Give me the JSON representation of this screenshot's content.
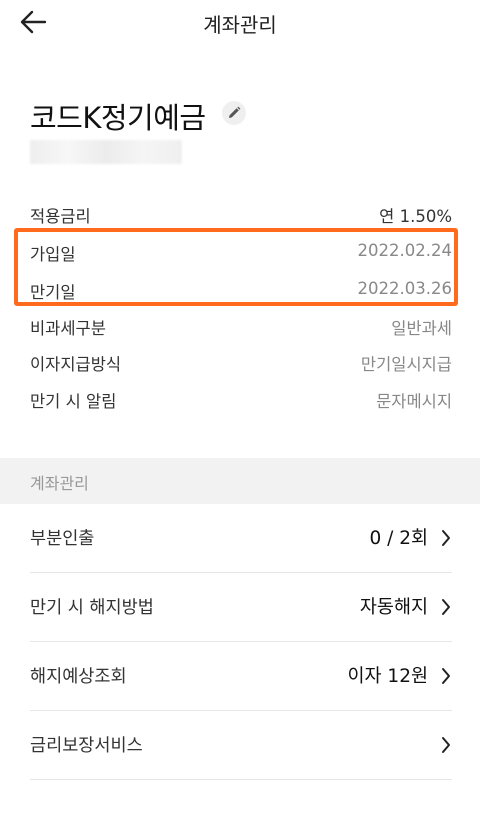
{
  "header": {
    "title": "계좌관리"
  },
  "product": {
    "name": "코드K정기예금"
  },
  "info": {
    "rate": {
      "label": "적용금리",
      "value": "연 1.50%"
    },
    "join_date": {
      "label": "가입일",
      "value": "2022.02.24"
    },
    "maturity_date": {
      "label": "만기일",
      "value": "2022.03.26"
    },
    "tax": {
      "label": "비과세구분",
      "value": "일반과세"
    },
    "interest_method": {
      "label": "이자지급방식",
      "value": "만기일시지급"
    },
    "maturity_notice": {
      "label": "만기 시 알림",
      "value": "문자메시지"
    }
  },
  "section": {
    "title": "계좌관리"
  },
  "manage": [
    {
      "label": "부분인출",
      "value": "0 / 2회"
    },
    {
      "label": "만기 시 해지방법",
      "value": "자동해지"
    },
    {
      "label": "해지예상조회",
      "value": "이자 12원"
    },
    {
      "label": "금리보장서비스",
      "value": ""
    }
  ],
  "colors": {
    "highlight": "#ff6a1c",
    "section_bg": "#f2f2f2"
  },
  "icons": {
    "back": "arrow-left",
    "edit": "pencil",
    "chevron": "chevron-right"
  }
}
